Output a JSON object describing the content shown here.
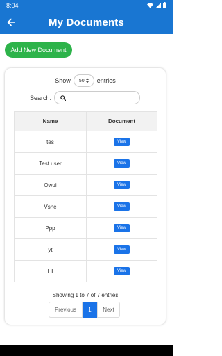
{
  "status_bar": {
    "time": "8:04"
  },
  "app_bar": {
    "title": "My Documents"
  },
  "add_button": {
    "label": "Add New Document"
  },
  "length": {
    "show_label": "Show",
    "value": "50",
    "entries_label": "entries"
  },
  "search": {
    "label": "Search:",
    "value": ""
  },
  "table": {
    "headers": [
      "Name",
      "Document"
    ],
    "rows": [
      {
        "name": "tes",
        "action": "View"
      },
      {
        "name": "Test user",
        "action": "View"
      },
      {
        "name": "Owui",
        "action": "View"
      },
      {
        "name": "Vshe",
        "action": "View"
      },
      {
        "name": "Ppp",
        "action": "View"
      },
      {
        "name": "yt",
        "action": "View"
      },
      {
        "name": "Lll",
        "action": "View"
      }
    ]
  },
  "info": "Showing 1 to 7 of 7 entries",
  "pagination": {
    "previous": "Previous",
    "current": "1",
    "next": "Next"
  },
  "colors": {
    "primary": "#1976d2",
    "add_button": "#2db34a",
    "view_button": "#1a73e8"
  }
}
